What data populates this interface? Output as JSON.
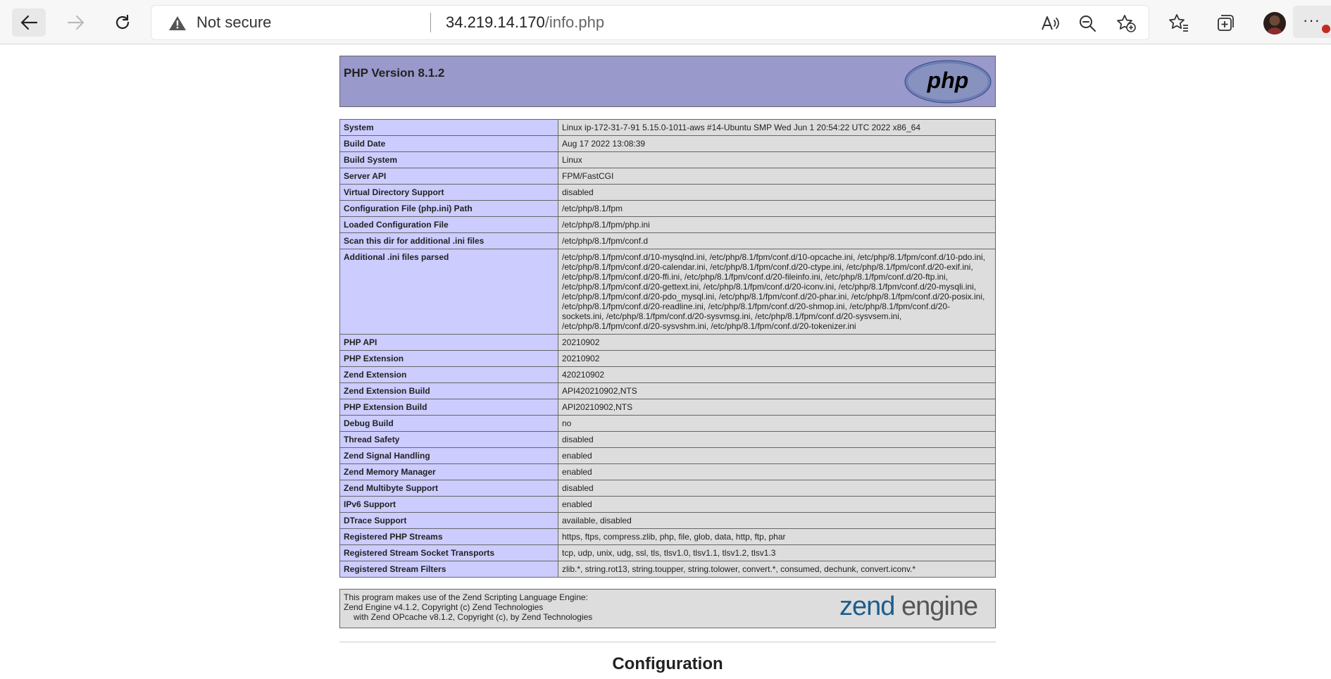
{
  "browser": {
    "security_label": "Not secure",
    "url_host": "34.219.14.170",
    "url_path": "/info.php"
  },
  "header": {
    "title": "PHP Version 8.1.2",
    "logo_text": "php"
  },
  "info_rows": [
    {
      "key": "System",
      "value": "Linux ip-172-31-7-91 5.15.0-1011-aws #14-Ubuntu SMP Wed Jun 1 20:54:22 UTC 2022 x86_64"
    },
    {
      "key": "Build Date",
      "value": "Aug 17 2022 13:08:39"
    },
    {
      "key": "Build System",
      "value": "Linux"
    },
    {
      "key": "Server API",
      "value": "FPM/FastCGI"
    },
    {
      "key": "Virtual Directory Support",
      "value": "disabled"
    },
    {
      "key": "Configuration File (php.ini) Path",
      "value": "/etc/php/8.1/fpm"
    },
    {
      "key": "Loaded Configuration File",
      "value": "/etc/php/8.1/fpm/php.ini"
    },
    {
      "key": "Scan this dir for additional .ini files",
      "value": "/etc/php/8.1/fpm/conf.d"
    },
    {
      "key": "Additional .ini files parsed",
      "value": "/etc/php/8.1/fpm/conf.d/10-mysqlnd.ini, /etc/php/8.1/fpm/conf.d/10-opcache.ini, /etc/php/8.1/fpm/conf.d/10-pdo.ini, /etc/php/8.1/fpm/conf.d/20-calendar.ini, /etc/php/8.1/fpm/conf.d/20-ctype.ini, /etc/php/8.1/fpm/conf.d/20-exif.ini, /etc/php/8.1/fpm/conf.d/20-ffi.ini, /etc/php/8.1/fpm/conf.d/20-fileinfo.ini, /etc/php/8.1/fpm/conf.d/20-ftp.ini, /etc/php/8.1/fpm/conf.d/20-gettext.ini, /etc/php/8.1/fpm/conf.d/20-iconv.ini, /etc/php/8.1/fpm/conf.d/20-mysqli.ini, /etc/php/8.1/fpm/conf.d/20-pdo_mysql.ini, /etc/php/8.1/fpm/conf.d/20-phar.ini, /etc/php/8.1/fpm/conf.d/20-posix.ini, /etc/php/8.1/fpm/conf.d/20-readline.ini, /etc/php/8.1/fpm/conf.d/20-shmop.ini, /etc/php/8.1/fpm/conf.d/20-sockets.ini, /etc/php/8.1/fpm/conf.d/20-sysvmsg.ini, /etc/php/8.1/fpm/conf.d/20-sysvsem.ini, /etc/php/8.1/fpm/conf.d/20-sysvshm.ini, /etc/php/8.1/fpm/conf.d/20-tokenizer.ini"
    },
    {
      "key": "PHP API",
      "value": "20210902"
    },
    {
      "key": "PHP Extension",
      "value": "20210902"
    },
    {
      "key": "Zend Extension",
      "value": "420210902"
    },
    {
      "key": "Zend Extension Build",
      "value": "API420210902,NTS"
    },
    {
      "key": "PHP Extension Build",
      "value": "API20210902,NTS"
    },
    {
      "key": "Debug Build",
      "value": "no"
    },
    {
      "key": "Thread Safety",
      "value": "disabled"
    },
    {
      "key": "Zend Signal Handling",
      "value": "enabled"
    },
    {
      "key": "Zend Memory Manager",
      "value": "enabled"
    },
    {
      "key": "Zend Multibyte Support",
      "value": "disabled"
    },
    {
      "key": "IPv6 Support",
      "value": "enabled"
    },
    {
      "key": "DTrace Support",
      "value": "available, disabled"
    },
    {
      "key": "Registered PHP Streams",
      "value": "https, ftps, compress.zlib, php, file, glob, data, http, ftp, phar"
    },
    {
      "key": "Registered Stream Socket Transports",
      "value": "tcp, udp, unix, udg, ssl, tls, tlsv1.0, tlsv1.1, tlsv1.2, tlsv1.3"
    },
    {
      "key": "Registered Stream Filters",
      "value": "zlib.*, string.rot13, string.toupper, string.tolower, convert.*, consumed, dechunk, convert.iconv.*"
    }
  ],
  "zend": {
    "line1": "This program makes use of the Zend Scripting Language Engine:",
    "line2": "Zend Engine v4.1.2, Copyright (c) Zend Technologies",
    "line3": "with Zend OPcache v8.1.2, Copyright (c), by Zend Technologies",
    "logo_word1": "zend",
    "logo_word2": "engine"
  },
  "section_title": "Configuration",
  "colors": {
    "header_bg": "#9999cc",
    "key_bg": "#ccccff",
    "value_bg": "#dddddd",
    "zend_blue": "#1b5e8c",
    "zend_gray": "#555555"
  }
}
